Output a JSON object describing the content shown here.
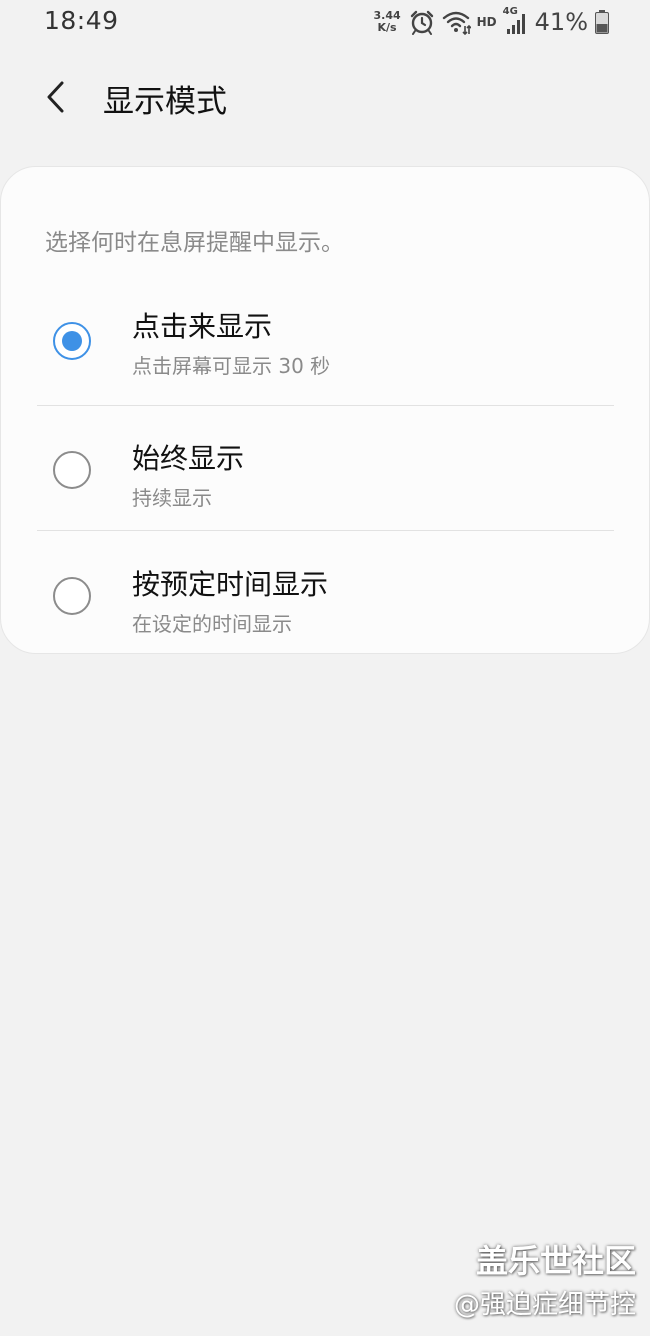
{
  "status_bar": {
    "time": "18:49",
    "net_speed_value": "3.44",
    "net_speed_unit": "K/s",
    "hd_label": "HD",
    "network_label": "4G",
    "battery_percent": "41%",
    "icons": [
      "alarm-icon",
      "wifi-icon",
      "signal-icon",
      "battery-icon"
    ]
  },
  "header": {
    "back_icon": "back-arrow-icon",
    "title": "显示模式"
  },
  "card": {
    "description": "选择何时在息屏提醒中显示。",
    "options": [
      {
        "title": "点击来显示",
        "subtitle": "点击屏幕可显示 30 秒",
        "selected": true
      },
      {
        "title": "始终显示",
        "subtitle": "持续显示",
        "selected": false
      },
      {
        "title": "按预定时间显示",
        "subtitle": "在设定的时间显示",
        "selected": false
      }
    ]
  },
  "watermark": {
    "title": "盖乐世社区",
    "handle": "@强迫症细节控"
  },
  "colors": {
    "accent": "#3e91e6",
    "background": "#f2f2f2",
    "card": "#fcfcfc"
  }
}
